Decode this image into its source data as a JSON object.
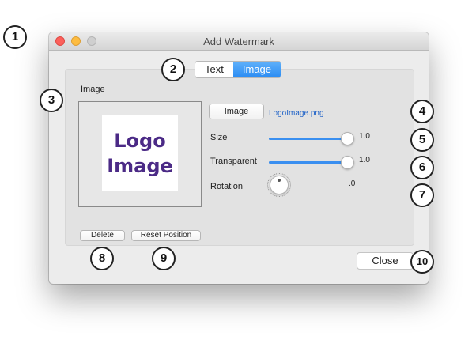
{
  "window": {
    "title": "Add Watermark"
  },
  "tabs": [
    {
      "label": "Text",
      "active": false
    },
    {
      "label": "Image",
      "active": true
    }
  ],
  "image_section": {
    "label": "Image",
    "preview_logo_line1": "Logo",
    "preview_logo_line2": "Image",
    "choose_button_label": "Image",
    "filename": "LogoImage.png"
  },
  "controls": {
    "size": {
      "label": "Size",
      "value_text": "1.0",
      "value": 1.0
    },
    "transparent": {
      "label": "Transparent",
      "value_text": "1.0",
      "value": 1.0
    },
    "rotation": {
      "label": "Rotation",
      "value_text": ".0"
    }
  },
  "buttons": {
    "delete": "Delete",
    "reset_position": "Reset Position",
    "close": "Close"
  },
  "callouts": [
    "1",
    "2",
    "3",
    "4",
    "5",
    "6",
    "7",
    "8",
    "9",
    "10"
  ],
  "colors": {
    "accent": "#2a8cf3",
    "logo_text": "#4b2a86",
    "filename_link": "#2264c8"
  }
}
